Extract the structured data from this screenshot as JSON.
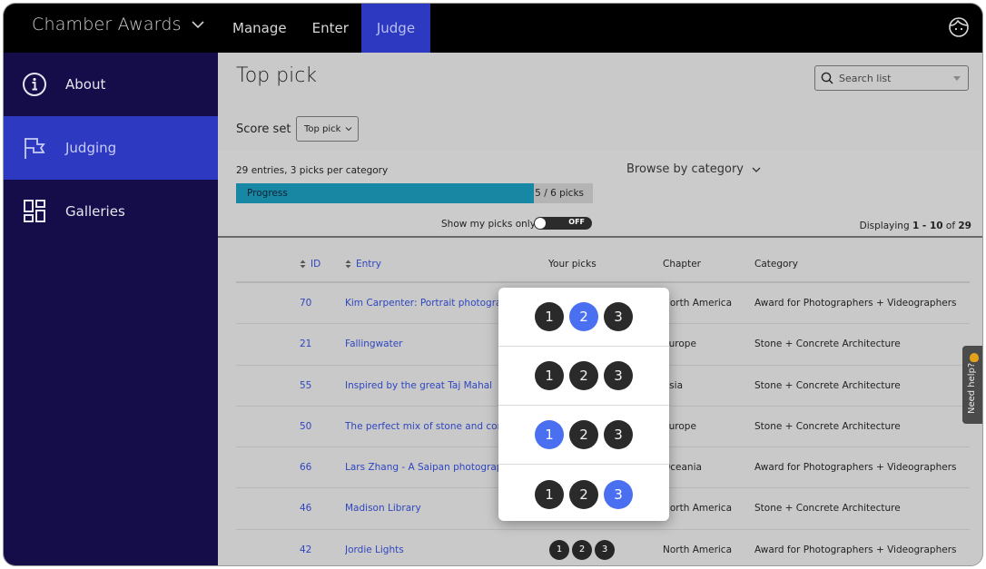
{
  "topbar": {
    "brand": "Chamber Awards",
    "nav": [
      {
        "label": "Manage",
        "active": false
      },
      {
        "label": "Enter",
        "active": false
      },
      {
        "label": "Judge",
        "active": true
      }
    ],
    "user_icon": "user-face-icon"
  },
  "sidebar": {
    "items": [
      {
        "label": "About",
        "icon": "info-icon",
        "active": false
      },
      {
        "label": "Judging",
        "icon": "flag-icon",
        "active": true
      },
      {
        "label": "Galleries",
        "icon": "galleries-grid-icon",
        "active": false
      }
    ]
  },
  "main": {
    "title": "Top pick",
    "search": {
      "placeholder": "Search list",
      "icon": "search-icon"
    },
    "score_set": {
      "label": "Score set",
      "selected": "Top pick"
    },
    "summary": "29 entries, 3 picks per category",
    "progress": {
      "label": "Progress",
      "count_text": "5 / 6 picks",
      "done": 5,
      "total": 6
    },
    "toggle": {
      "label": "Show my picks only",
      "state": "OFF"
    },
    "browse": "Browse by category",
    "displaying": {
      "prefix": "Displaying",
      "range": "1 - 10",
      "of": "of",
      "total": "29"
    }
  },
  "table": {
    "headers": {
      "id": "ID",
      "entry": "Entry",
      "picks": "Your picks",
      "chapter": "Chapter",
      "category": "Category"
    },
    "rows": [
      {
        "id": "70",
        "entry": "Kim Carpenter: Portrait photographer",
        "chapter": "North America",
        "category": "Award for Photographers + Videographers"
      },
      {
        "id": "21",
        "entry": "Fallingwater",
        "chapter": "Europe",
        "category": "Stone + Concrete Architecture"
      },
      {
        "id": "55",
        "entry": "Inspired by the great Taj Mahal",
        "chapter": "Asia",
        "category": "Stone + Concrete Architecture"
      },
      {
        "id": "50",
        "entry": "The perfect mix of stone and concrete",
        "chapter": "Europe",
        "category": "Stone + Concrete Architecture"
      },
      {
        "id": "66",
        "entry": "Lars Zhang - A Saipan photographer",
        "chapter": "Oceania",
        "category": "Award for Photographers + Videographers"
      },
      {
        "id": "46",
        "entry": "Madison Library",
        "chapter": "North America",
        "category": "Stone + Concrete Architecture"
      },
      {
        "id": "42",
        "entry": "Jordie Lights",
        "chapter": "North America",
        "category": "Award for Photographers + Videographers"
      }
    ],
    "inline_picks": [
      "1",
      "2",
      "3"
    ]
  },
  "popover": {
    "rows": [
      {
        "options": [
          "1",
          "2",
          "3"
        ],
        "selected": "2"
      },
      {
        "options": [
          "1",
          "2",
          "3"
        ],
        "selected": null
      },
      {
        "options": [
          "1",
          "2",
          "3"
        ],
        "selected": "1"
      },
      {
        "options": [
          "1",
          "2",
          "3"
        ],
        "selected": "3"
      }
    ]
  },
  "help": {
    "label": "Need help?",
    "icon": "waving-hand-icon"
  },
  "colors": {
    "accent": "#2e39c2",
    "sidebar": "#140d4a",
    "progress": "#1787a4",
    "pick_selected": "#4a6ff0",
    "link": "#2f46c0"
  }
}
